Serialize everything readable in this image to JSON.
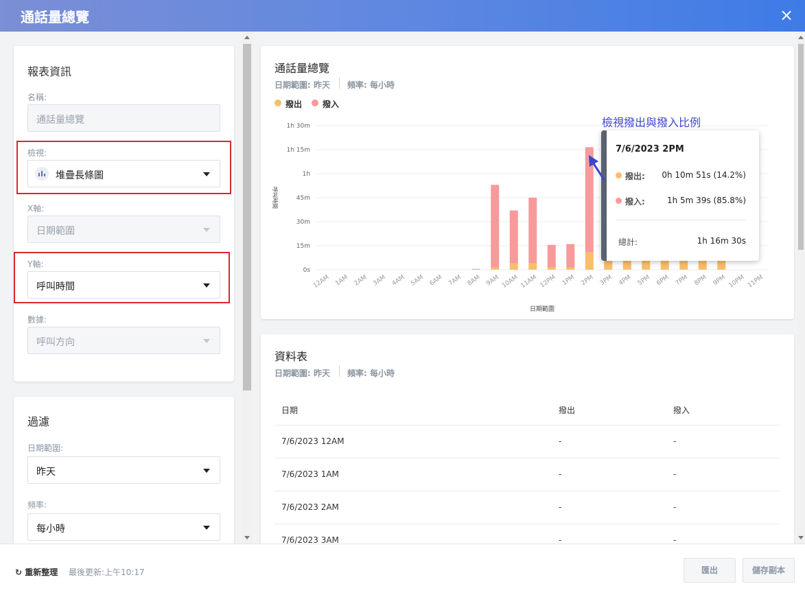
{
  "window": {
    "title": "通話量總覽",
    "close_icon": "×"
  },
  "report_info": {
    "title": "報表資訊",
    "name_label": "名稱:",
    "name_placeholder": "通話量總覽",
    "view_label": "檢視:",
    "view_value": "堆疊長條圖",
    "view_icon": "bar-chart-icon",
    "x_axis_label": "X軸:",
    "x_axis_value": "日期範圍",
    "y_axis_label": "Y軸:",
    "y_axis_value": "呼叫時間",
    "data_label": "數據:",
    "data_value": "呼叫方向"
  },
  "filter": {
    "title": "過濾",
    "date_range_label": "日期範圍:",
    "date_range_value": "昨天",
    "frequency_label": "頻率:",
    "frequency_value": "每小時"
  },
  "chart_card": {
    "title": "通話量總覽",
    "date_range": "日期範圍: 昨天",
    "frequency": "頻率: 每小時",
    "annotation": "檢視撥出與撥入比例"
  },
  "tooltip": {
    "header": "7/6/2023 2PM",
    "outbound_label": "撥出:",
    "outbound_value": "0h 10m 51s (14.2%)",
    "inbound_label": "撥入:",
    "inbound_value": "1h 5m 39s (85.8%)",
    "total_label": "總計:",
    "total_value": "1h 16m 30s"
  },
  "chart_data": {
    "type": "bar",
    "stacked": true,
    "title": "",
    "xlabel": "日期範圍",
    "ylabel": "呼叫時間",
    "categories": [
      "12AM",
      "1AM",
      "2AM",
      "3AM",
      "4AM",
      "5AM",
      "6AM",
      "7AM",
      "8AM",
      "9AM",
      "10AM",
      "11AM",
      "12PM",
      "1PM",
      "2PM",
      "3PM",
      "4PM",
      "5PM",
      "6PM",
      "7PM",
      "8PM",
      "9PM",
      "10PM",
      "11PM"
    ],
    "y_ticks": [
      "0s",
      "15m",
      "30m",
      "45m",
      "1h",
      "1h 15m",
      "1h 30m"
    ],
    "ylim": [
      0,
      90
    ],
    "y_unit": "minutes",
    "series": [
      {
        "name": "撥出",
        "color": "#f9be6a",
        "values": [
          0,
          0,
          0,
          0,
          0,
          0,
          0,
          0,
          0.2,
          1.5,
          4,
          4,
          1.5,
          1.5,
          10.85,
          8,
          9,
          9,
          8,
          7,
          7,
          6,
          0,
          0
        ]
      },
      {
        "name": "撥入",
        "color": "#f69a9c",
        "values": [
          0,
          0,
          0,
          0,
          0,
          0,
          0,
          0,
          0.3,
          51.5,
          33,
          41,
          14,
          14.5,
          65.65,
          45,
          40,
          42,
          38,
          35,
          30,
          25,
          0,
          0
        ]
      }
    ],
    "grid": true,
    "legend_position": "top-left"
  },
  "data_table": {
    "title": "資料表",
    "date_range": "日期範圍: 昨天",
    "frequency": "頻率: 每小時",
    "columns": [
      "日期",
      "撥出",
      "撥入"
    ],
    "rows": [
      [
        "7/6/2023 12AM",
        "-",
        "-"
      ],
      [
        "7/6/2023 1AM",
        "-",
        "-"
      ],
      [
        "7/6/2023 2AM",
        "-",
        "-"
      ],
      [
        "7/6/2023 3AM",
        "-",
        "-"
      ]
    ]
  },
  "footer": {
    "refresh_label": "重新整理",
    "refresh_icon": "refresh-icon",
    "last_updated": "最後更新:上午10:17",
    "export_label": "匯出",
    "save_copy_label": "儲存副本"
  }
}
